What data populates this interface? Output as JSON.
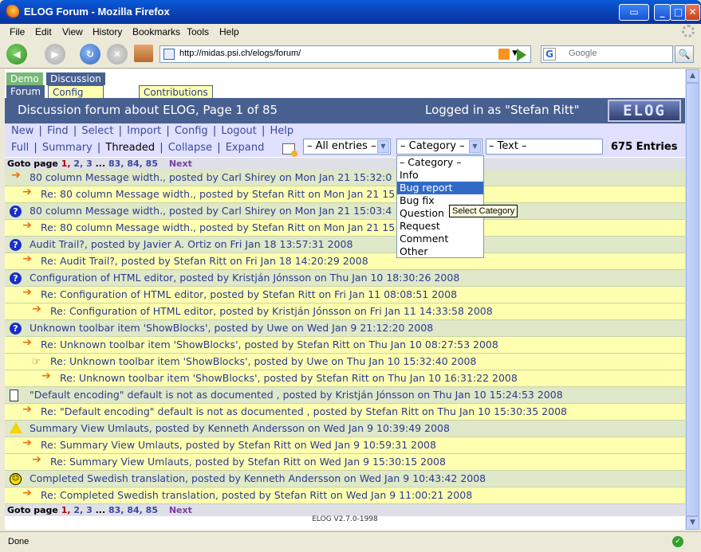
{
  "window": {
    "title": "ELOG Forum - Mozilla Firefox"
  },
  "menubar": [
    "File",
    "Edit",
    "View",
    "History",
    "Bookmarks",
    "Tools",
    "Help"
  ],
  "navbar": {
    "url": "http://midas.psi.ch/elogs/forum/",
    "search_placeholder": "Google",
    "search_engine_icon": "G"
  },
  "elog": {
    "group_tabs": [
      "Demo",
      "Discussion"
    ],
    "logbook_tabs": [
      "Forum",
      "Config Examples",
      "Contributions"
    ],
    "header_left": "Discussion forum about ELOG, Page 1 of 85",
    "header_right": "Logged in as \"Stefan Ritt\"",
    "logo_text": "ELOG",
    "menu1": [
      "New",
      "Find",
      "Select",
      "Import",
      "Config",
      "Logout",
      "Help"
    ],
    "menu2": {
      "full": "Full",
      "summary": "Summary",
      "threaded": "Threaded",
      "collapse": "Collapse",
      "expand": "Expand"
    },
    "filter_entries": "– All entries –",
    "filter_category": "– Category –",
    "filter_text": "– Text –",
    "entries_count": "675 Entries",
    "goto": {
      "label": "Goto page",
      "pages": [
        "1,",
        "2,",
        "3",
        "...",
        "83,",
        "84,",
        "85"
      ],
      "next": "Next"
    },
    "category_options": [
      "– Category –",
      "Info",
      "Bug report",
      "Bug fix",
      "Question",
      "Request",
      "Comment",
      "Other"
    ],
    "highlighted_option": "Bug report",
    "tooltip": "Select Category",
    "rows": [
      {
        "level": 0,
        "icon": "arrow",
        "text": "80 column Message width., posted by Carl Shirey on Mon Jan 21 15:32:0"
      },
      {
        "level": 1,
        "icon": "arrow",
        "text": "Re: 80 column Message width., posted by Stefan Ritt on Mon Jan 21 15"
      },
      {
        "level": 0,
        "icon": "question",
        "text": "80 column Message width., posted by Carl Shirey on Mon Jan 21 15:03:4"
      },
      {
        "level": 1,
        "icon": "arrow",
        "text": "Re: 80 column Message width., posted by Stefan Ritt on Mon Jan 21 15"
      },
      {
        "level": 0,
        "icon": "question",
        "text": "Audit Trail?, posted by Javier A. Ortiz on Fri Jan 18 13:57:31 2008"
      },
      {
        "level": 1,
        "icon": "arrow",
        "text": "Re: Audit Trail?, posted by Stefan Ritt on Fri Jan 18 14:20:29 2008"
      },
      {
        "level": 0,
        "icon": "question",
        "text": "Configuration of HTML editor, posted by Kristján Jónsson on Thu Jan 10 18:30:26 2008"
      },
      {
        "level": 1,
        "icon": "arrow",
        "text": "Re: Configuration of HTML editor, posted by Stefan Ritt on Fri Jan 11 08:08:51 2008"
      },
      {
        "level": 2,
        "icon": "arrow",
        "text": "Re: Configuration of HTML editor, posted by Kristján Jónsson on Fri Jan 11 14:33:58 2008"
      },
      {
        "level": 0,
        "icon": "question",
        "text": "Unknown toolbar item 'ShowBlocks', posted by Uwe on Wed Jan 9 21:12:20 2008"
      },
      {
        "level": 1,
        "icon": "arrow",
        "text": "Re: Unknown toolbar item 'ShowBlocks', posted by Stefan Ritt on Thu Jan 10 08:27:53 2008"
      },
      {
        "level": 2,
        "icon": "hand",
        "text": "Re: Unknown toolbar item 'ShowBlocks', posted by Uwe on Thu Jan 10 15:32:40 2008"
      },
      {
        "level": 3,
        "icon": "arrow",
        "text": "Re: Unknown toolbar item 'ShowBlocks', posted by Stefan Ritt on Thu Jan 10 16:31:22 2008"
      },
      {
        "level": 0,
        "icon": "doc",
        "text": "\"Default encoding\" default is not as documented , posted by Kristján Jónsson on Thu Jan 10 15:24:53 2008"
      },
      {
        "level": 1,
        "icon": "arrow",
        "text": "Re: \"Default encoding\" default is not as documented , posted by Stefan Ritt on Thu Jan 10 15:30:35 2008"
      },
      {
        "level": 0,
        "icon": "warning",
        "text": "Summary View Umlauts, posted by Kenneth Andersson on Wed Jan 9 10:39:49 2008"
      },
      {
        "level": 1,
        "icon": "arrow",
        "text": "Re: Summary View Umlauts, posted by Stefan Ritt on Wed Jan 9 10:59:31 2008"
      },
      {
        "level": 2,
        "icon": "arrow",
        "text": "Re: Summary View Umlauts, posted by Stefan Ritt on Wed Jan 9 15:30:15 2008"
      },
      {
        "level": 0,
        "icon": "smiley",
        "text": "Completed Swedish translation, posted by Kenneth Andersson on Wed Jan 9 10:43:42 2008"
      },
      {
        "level": 1,
        "icon": "arrow",
        "text": "Re: Completed Swedish translation, posted by Stefan Ritt on Wed Jan 9 11:00:21 2008"
      }
    ],
    "version": "ELOG V2.7.0-1998"
  },
  "status": "Done"
}
